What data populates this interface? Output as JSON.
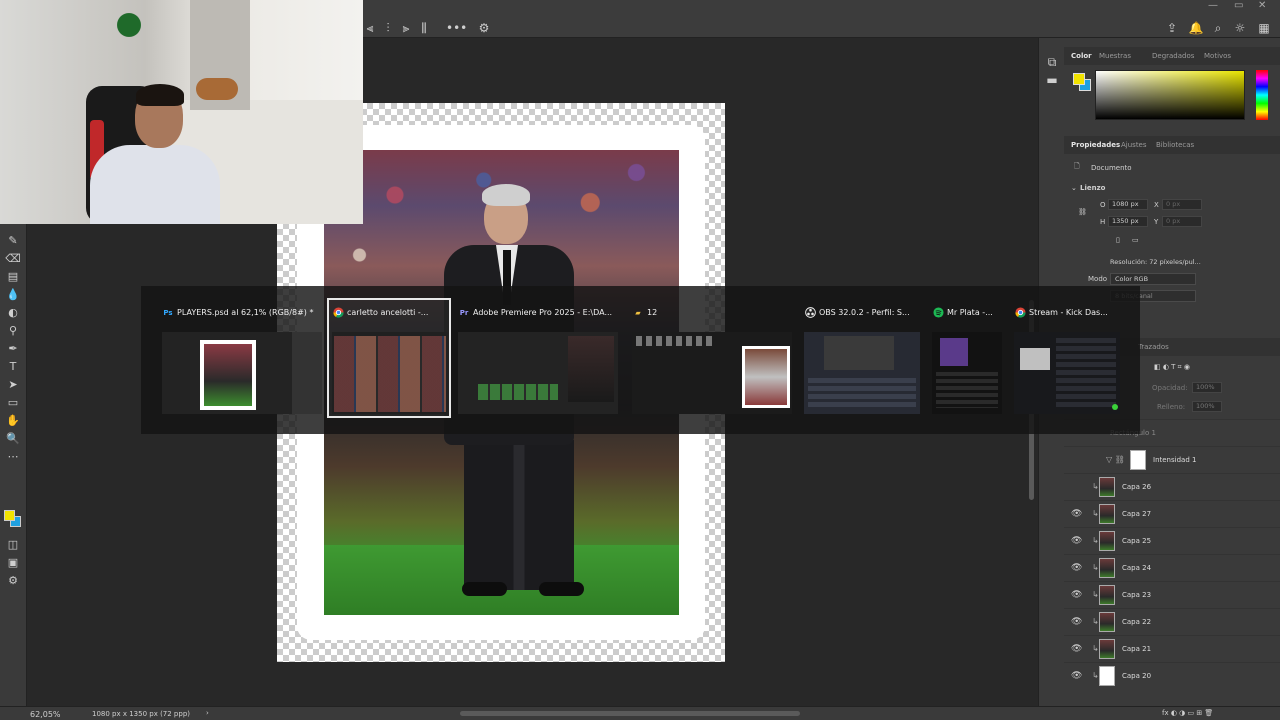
{
  "switcher": {
    "windows": [
      {
        "title": "PLAYERS.psd al 62,1% (RGB/8#) *",
        "icon": "photoshop-icon",
        "icon_text": "Ps",
        "selected": false
      },
      {
        "title": "carletto ancelotti -...",
        "icon": "chrome-icon",
        "icon_text": "",
        "selected": true
      },
      {
        "title": "Adobe Premiere Pro 2025 - E:\\DA...",
        "icon": "premiere-icon",
        "icon_text": "Pr",
        "selected": false
      },
      {
        "title": "12",
        "icon": "folder-icon",
        "icon_text": "",
        "selected": false
      },
      {
        "title": "OBS 32.0.2 - Perfil: S...",
        "icon": "obs-icon",
        "icon_text": "",
        "selected": false
      },
      {
        "title": "Mr Plata -...",
        "icon": "spotify-icon",
        "icon_text": "",
        "selected": false
      },
      {
        "title": "Stream - Kick Das...",
        "icon": "chrome-icon",
        "icon_text": "",
        "selected": false
      }
    ]
  },
  "color_panel": {
    "tabs": [
      "Color",
      "Muestras",
      "Degradados",
      "Motivos"
    ],
    "fg_color": "#f2e300",
    "bg_color": "#1fa0e0"
  },
  "properties_panel": {
    "tabs": [
      "Propiedades",
      "Ajustes",
      "Bibliotecas"
    ],
    "document_label": "Documento",
    "section_label": "Lienzo",
    "width_label": "O",
    "width_value": "1080 px",
    "height_label": "H",
    "height_value": "1350 px",
    "x_label": "X",
    "x_placeholder": "0 px",
    "y_label": "Y",
    "y_placeholder": "0 px",
    "resolution_text": "Resolución: 72 píxeles/pul...",
    "mode_label": "Modo",
    "mode_value": "Color RGB",
    "depth_value": "8 bits/canal"
  },
  "layers_panel": {
    "tab_trazados": "Trazados",
    "opacity_label": "Opacidad:",
    "opacity_value": "100%",
    "fill_label": "Relleno:",
    "fill_value": "100%",
    "group_layer": "Rectángulo 1",
    "adjustment_layer": "Intensidad 1",
    "layers": [
      "Capa 26",
      "Capa 27",
      "Capa 25",
      "Capa 24",
      "Capa 23",
      "Capa 22",
      "Capa 21",
      "Capa 20"
    ]
  },
  "status": {
    "zoom": "62,05%",
    "doc_size": "1080 px x 1350 px (72 ppp)"
  }
}
